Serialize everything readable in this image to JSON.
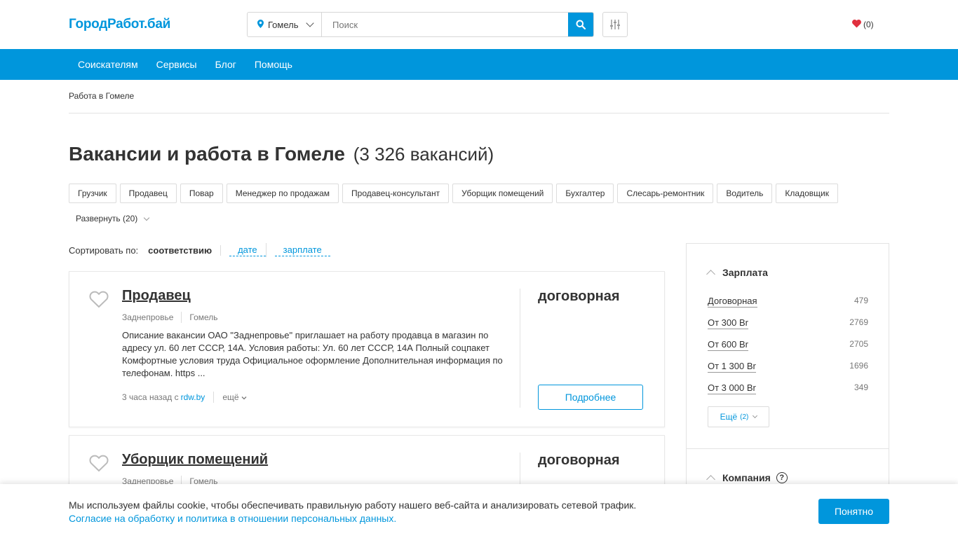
{
  "header": {
    "logo": "ГородРабот.бай",
    "city": "Гомель",
    "search_placeholder": "Поиск",
    "favorites_count": "(0)"
  },
  "nav": {
    "items": [
      "Соискателям",
      "Сервисы",
      "Блог",
      "Помощь"
    ]
  },
  "breadcrumb": "Работа в Гомеле",
  "page": {
    "title": "Вакансии и работа в Гомеле",
    "count": "(3 326 вакансий)"
  },
  "tags": [
    "Грузчик",
    "Продавец",
    "Повар",
    "Менеджер по продажам",
    "Продавец-консультант",
    "Уборщик помещений",
    "Бухгалтер",
    "Слесарь-ремонтник",
    "Водитель",
    "Кладовщик"
  ],
  "expand_label": "Развернуть (20)",
  "sort": {
    "label": "Сортировать по:",
    "active": "соответствию",
    "options": [
      "дате",
      "зарплате"
    ]
  },
  "vacancies": [
    {
      "title": "Продавец",
      "company": "Заднепровье",
      "city": "Гомель",
      "description": "Описание вакансии ОАО \"Заднепровье\" приглашает на работу продавца в магазин по адресу ул. 60 лет СССР, 14А. Условия работы: Ул. 60 лет СССР, 14А Полный соцпакет Комфортные условия труда Официальное оформление Дополнительная информация по телефонам. https ...",
      "posted": "3 часа назад с",
      "source": "rdw.by",
      "more": "ещё",
      "salary": "договорная",
      "button": "Подробнее"
    },
    {
      "title": "Уборщик помещений",
      "company": "Заднепровье",
      "city": "Гомель",
      "salary": "договорная"
    }
  ],
  "sidebar": {
    "salary_heading": "Зарплата",
    "salary_items": [
      {
        "label": "Договорная",
        "count": "479"
      },
      {
        "label": "От 300 Br",
        "count": "2769"
      },
      {
        "label": "От 600 Br",
        "count": "2705"
      },
      {
        "label": "От 1 300 Br",
        "count": "1696"
      },
      {
        "label": "От 3 000 Br",
        "count": "349"
      }
    ],
    "more_label": "Ещё",
    "more_count": "(2)",
    "company_heading": "Компания",
    "help_glyph": "?"
  },
  "cookie": {
    "text": "Мы используем файлы cookie, чтобы обеспечивать правильную работу нашего веб-сайта и анализировать сетевой трафик.",
    "link": "Согласие на обработку и политика в отношении персональных данных.",
    "button": "Понятно"
  },
  "colors": {
    "accent": "#0096dc",
    "heart": "#e0303e"
  }
}
